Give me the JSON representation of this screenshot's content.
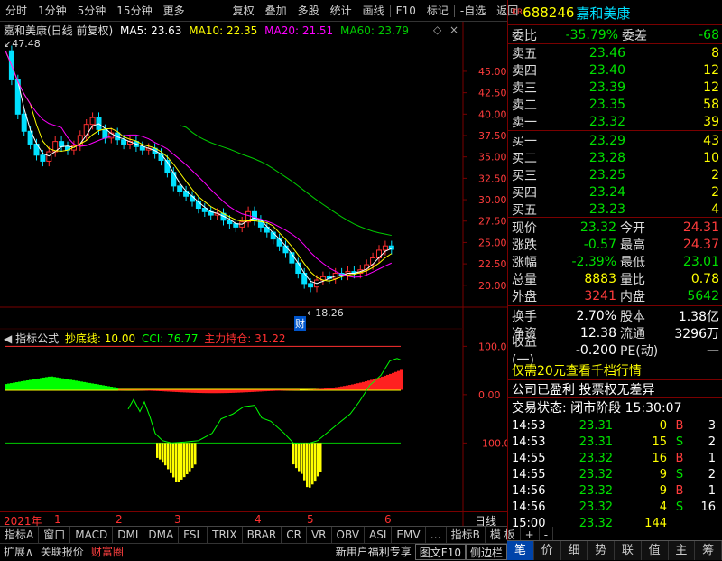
{
  "toolbar": {
    "items": [
      "分时",
      "1分钟",
      "5分钟",
      "15分钟",
      "更多",
      "复权",
      "叠加",
      "多股",
      "统计",
      "画线",
      "F10",
      "标记",
      "-自选",
      "返回"
    ]
  },
  "chart_header": {
    "title": "嘉和美康(日线 前复权)",
    "ma5": "MA5: 23.63",
    "ma10": "MA10: 22.35",
    "ma20": "MA20: 21.51",
    "ma60": "MA60: 23.79",
    "high_mark": "47.48",
    "low_mark": "18.26",
    "fin_mark": "财"
  },
  "chart_data": [
    {
      "type": "candlestick",
      "title": "嘉和美康(日线 前复权)",
      "y_ticks": [
        "45.00",
        "42.50",
        "40.00",
        "37.50",
        "35.00",
        "32.50",
        "30.00",
        "27.50",
        "25.00",
        "22.50",
        "20.00"
      ],
      "ylim": [
        18.5,
        47
      ],
      "x_labels": [
        "2021年",
        "1",
        "2",
        "3",
        "4",
        "5",
        "6"
      ],
      "series": [
        {
          "name": "MA5: 23.63",
          "color": "#ffffff"
        },
        {
          "name": "MA10: 22.35",
          "color": "#ffff00"
        },
        {
          "name": "MA20: 21.51",
          "color": "#ff00ff"
        },
        {
          "name": "MA60: 23.79",
          "color": "#00cc00"
        }
      ],
      "close_path": [
        [
          0,
          47.4
        ],
        [
          2,
          44
        ],
        [
          4,
          40
        ],
        [
          6,
          38
        ],
        [
          8,
          36.5
        ],
        [
          10,
          35.2
        ],
        [
          12,
          34.5
        ],
        [
          14,
          35.6
        ],
        [
          16,
          36.8
        ],
        [
          18,
          36.2
        ],
        [
          20,
          35.8
        ],
        [
          22,
          36.3
        ],
        [
          24,
          37.5
        ],
        [
          26,
          38.8
        ],
        [
          28,
          39.6
        ],
        [
          30,
          38.2
        ],
        [
          32,
          37.2
        ],
        [
          34,
          37.8
        ],
        [
          36,
          37.0
        ],
        [
          38,
          36.5
        ],
        [
          40,
          36.8
        ],
        [
          42,
          36.2
        ],
        [
          44,
          35.8
        ],
        [
          46,
          36.0
        ],
        [
          48,
          35.4
        ],
        [
          50,
          34.6
        ],
        [
          52,
          33.2
        ],
        [
          54,
          31.6
        ],
        [
          56,
          31.0
        ],
        [
          58,
          30.4
        ],
        [
          60,
          29.8
        ],
        [
          62,
          29.0
        ],
        [
          64,
          28.6
        ],
        [
          66,
          28.2
        ],
        [
          68,
          28.4
        ],
        [
          70,
          27.6
        ],
        [
          72,
          27.2
        ],
        [
          74,
          26.8
        ],
        [
          76,
          27.4
        ],
        [
          78,
          28.6
        ],
        [
          80,
          27.6
        ],
        [
          82,
          26.8
        ],
        [
          84,
          26.2
        ],
        [
          86,
          25.4
        ],
        [
          88,
          24.6
        ],
        [
          90,
          23.8
        ],
        [
          92,
          22.6
        ],
        [
          94,
          21.4
        ],
        [
          96,
          20.2
        ],
        [
          98,
          19.8
        ],
        [
          100,
          20.6
        ],
        [
          102,
          21.0
        ],
        [
          104,
          20.8
        ],
        [
          106,
          21.4
        ],
        [
          108,
          21.2
        ],
        [
          110,
          21.6
        ],
        [
          112,
          21.4
        ],
        [
          114,
          21.8
        ],
        [
          116,
          22.4
        ],
        [
          118,
          23.2
        ],
        [
          120,
          24.1
        ],
        [
          122,
          24.6
        ],
        [
          124,
          24.2
        ]
      ]
    },
    {
      "type": "bar",
      "title": "指标公式",
      "y_ticks": [
        "100.0",
        "0.00",
        "-100.0"
      ],
      "ylim": [
        -260,
        110
      ],
      "series": [
        {
          "name": "抄底线: 10.00",
          "color": "#ffff00"
        },
        {
          "name": "CCI: 76.77",
          "color": "#00ff00"
        },
        {
          "name": "主力持仓: 31.22",
          "color": "#ff3030"
        }
      ]
    }
  ],
  "indicator_header": {
    "name": "指标公式",
    "chao_di": "抄底线: 10.00",
    "cci": "CCI: 76.77",
    "zhuli": "主力持仓: 31.22"
  },
  "x_axis": {
    "year": "2021年",
    "months": [
      "1",
      "2",
      "3",
      "4",
      "5",
      "6"
    ],
    "right": "日线"
  },
  "bottom_tabs": [
    "指标A",
    "窗口",
    "MACD",
    "DMI",
    "DMA",
    "FSL",
    "TRIX",
    "BRAR",
    "CR",
    "VR",
    "OBV",
    "ASI",
    "EMV",
    "…",
    "指标B",
    "模 板",
    "+",
    "-"
  ],
  "status_bar": {
    "items": [
      "扩展∧",
      "关联报价",
      "财富圈"
    ],
    "promo": "新用户福利专享",
    "f10": "图文F10",
    "side": "侧边栏"
  },
  "quote": {
    "code_prefix": "KR",
    "code": "688246",
    "name": "嘉和美康",
    "weibi_label": "委比",
    "weibi": "-35.79%",
    "weicha_label": "委差",
    "weicha": "-68",
    "asks": [
      {
        "label": "卖五",
        "price": "23.46",
        "vol": "8"
      },
      {
        "label": "卖四",
        "price": "23.40",
        "vol": "12"
      },
      {
        "label": "卖三",
        "price": "23.39",
        "vol": "12"
      },
      {
        "label": "卖二",
        "price": "23.35",
        "vol": "58"
      },
      {
        "label": "卖一",
        "price": "23.32",
        "vol": "39"
      }
    ],
    "bids": [
      {
        "label": "买一",
        "price": "23.29",
        "vol": "43"
      },
      {
        "label": "买二",
        "price": "23.28",
        "vol": "10"
      },
      {
        "label": "买三",
        "price": "23.25",
        "vol": "2"
      },
      {
        "label": "买四",
        "price": "23.24",
        "vol": "2"
      },
      {
        "label": "买五",
        "price": "23.23",
        "vol": "4"
      }
    ],
    "stats": [
      {
        "l1": "现价",
        "v1": "23.32",
        "c1": "green",
        "l2": "今开",
        "v2": "24.31",
        "c2": "red"
      },
      {
        "l1": "涨跌",
        "v1": "-0.57",
        "c1": "green",
        "l2": "最高",
        "v2": "24.37",
        "c2": "red"
      },
      {
        "l1": "涨幅",
        "v1": "-2.39%",
        "c1": "green",
        "l2": "最低",
        "v2": "23.01",
        "c2": "green"
      },
      {
        "l1": "总量",
        "v1": "8883",
        "c1": "yellow",
        "l2": "量比",
        "v2": "0.78",
        "c2": "yellow"
      },
      {
        "l1": "外盘",
        "v1": "3241",
        "c1": "red",
        "l2": "内盘",
        "v2": "5642",
        "c2": "green"
      }
    ],
    "stats2": [
      {
        "l1": "换手",
        "v1": "2.70%",
        "l2": "股本",
        "v2": "1.38亿"
      },
      {
        "l1": "净资",
        "v1": "12.38",
        "l2": "流通",
        "v2": "3296万"
      },
      {
        "l1": "收益(一)",
        "v1": "-0.200",
        "l2": "PE(动)",
        "v2": "—"
      }
    ],
    "promo": "仅需20元查看千档行情",
    "notice": "公司已盈利 投票权无差异",
    "trade_status": "交易状态: 闭市阶段 15:30:07",
    "ticks": [
      {
        "t": "14:53",
        "p": "23.31",
        "v": "0",
        "s": "B"
      },
      {
        "t": "14:53",
        "p": "23.31",
        "v": "15",
        "s": "S"
      },
      {
        "t": "14:55",
        "p": "23.32",
        "v": "16",
        "s": "B"
      },
      {
        "t": "14:55",
        "p": "23.32",
        "v": "9",
        "s": "S"
      },
      {
        "t": "14:56",
        "p": "23.32",
        "v": "9",
        "s": "B"
      },
      {
        "t": "14:56",
        "p": "23.32",
        "v": "4",
        "s": "S"
      },
      {
        "t": "15:00",
        "p": "23.32",
        "v": "144",
        "s": ""
      }
    ],
    "ticks_extra": [
      "3",
      "2",
      "1",
      "2",
      "1",
      "16"
    ]
  },
  "right_tabs": [
    "笔",
    "价",
    "细",
    "势",
    "联",
    "值",
    "主",
    "筹"
  ]
}
